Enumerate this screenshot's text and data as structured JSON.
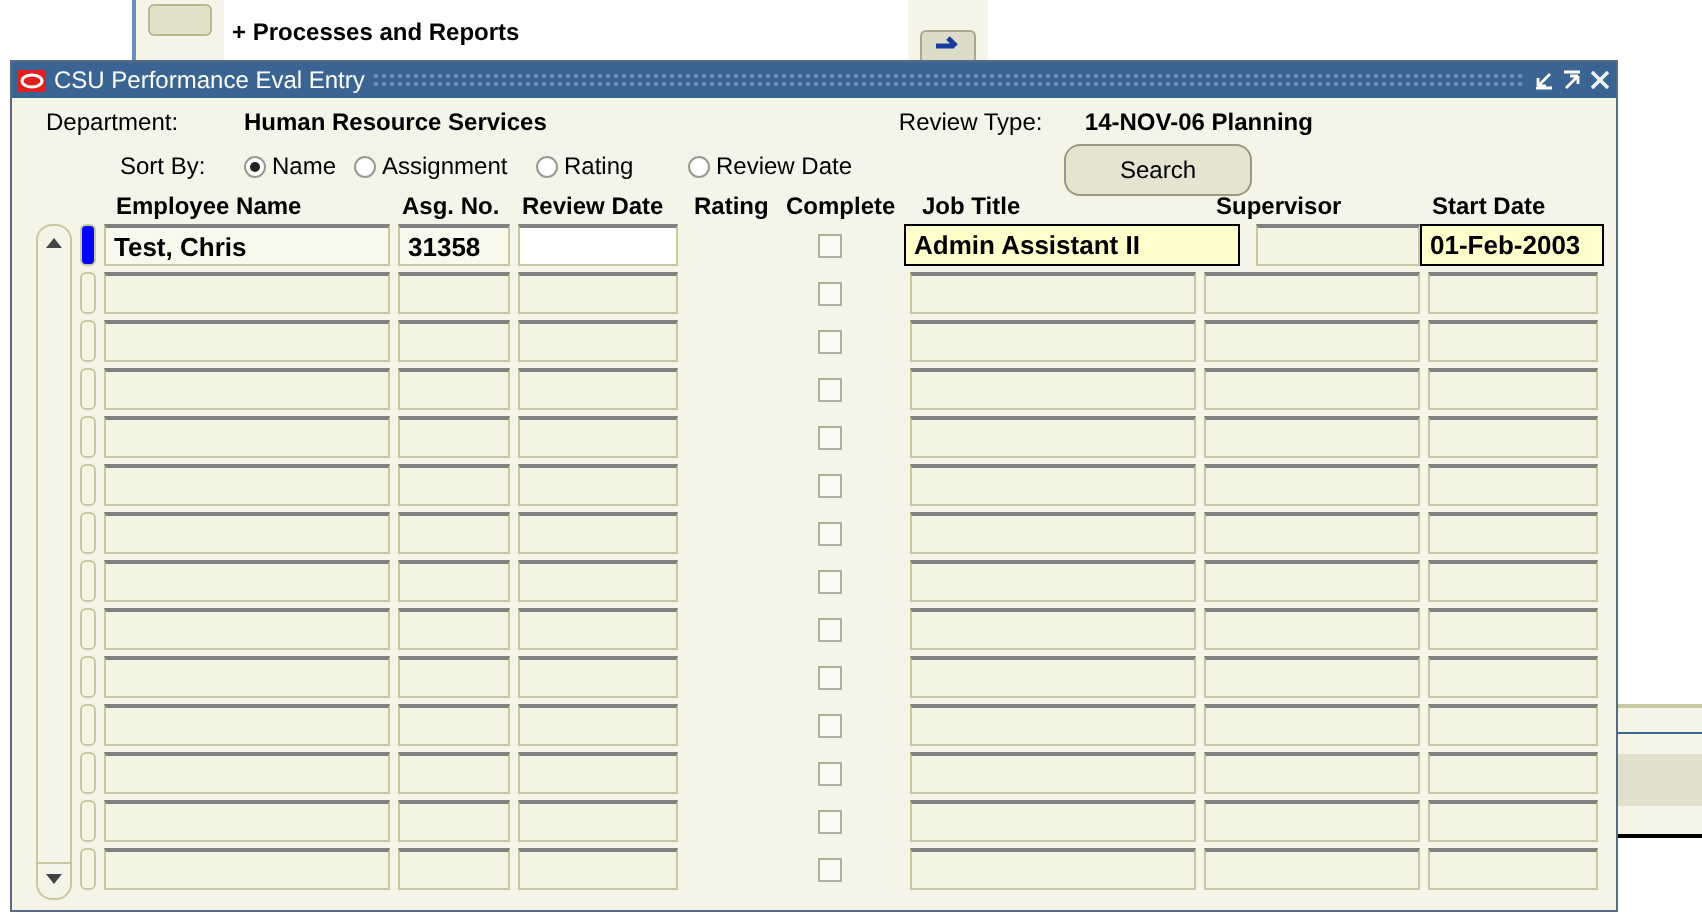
{
  "background": {
    "menu_item": "+ Processes and Reports"
  },
  "window": {
    "title": "CSU Performance Eval Entry"
  },
  "department": {
    "label": "Department:",
    "value": "Human Resource Services"
  },
  "review_type": {
    "label": "Review Type:",
    "value": "14-NOV-06 Planning"
  },
  "sort_by": {
    "label": "Sort By:",
    "options": [
      {
        "label": "Name",
        "selected": true
      },
      {
        "label": "Assignment",
        "selected": false
      },
      {
        "label": "Rating",
        "selected": false
      },
      {
        "label": "Review Date",
        "selected": false
      }
    ]
  },
  "search_button": "Search",
  "columns": [
    "Employee Name",
    "Asg. No.",
    "Review Date",
    "Rating",
    "Complete",
    "Job Title",
    "Supervisor",
    "Start Date"
  ],
  "rows": [
    {
      "current": true,
      "complete": false,
      "employee_name": "Test, Chris",
      "asg_no": "31358",
      "job_title": "Admin Assistant II",
      "start_date": "01-Feb-2003"
    },
    {
      "current": false,
      "complete": false
    },
    {
      "current": false,
      "complete": false
    },
    {
      "current": false,
      "complete": false
    },
    {
      "current": false,
      "complete": false
    },
    {
      "current": false,
      "complete": false
    },
    {
      "current": false,
      "complete": false
    },
    {
      "current": false,
      "complete": false
    },
    {
      "current": false,
      "complete": false
    },
    {
      "current": false,
      "complete": false
    },
    {
      "current": false,
      "complete": false
    },
    {
      "current": false,
      "complete": false
    },
    {
      "current": false,
      "complete": false
    },
    {
      "current": false,
      "complete": false
    }
  ]
}
